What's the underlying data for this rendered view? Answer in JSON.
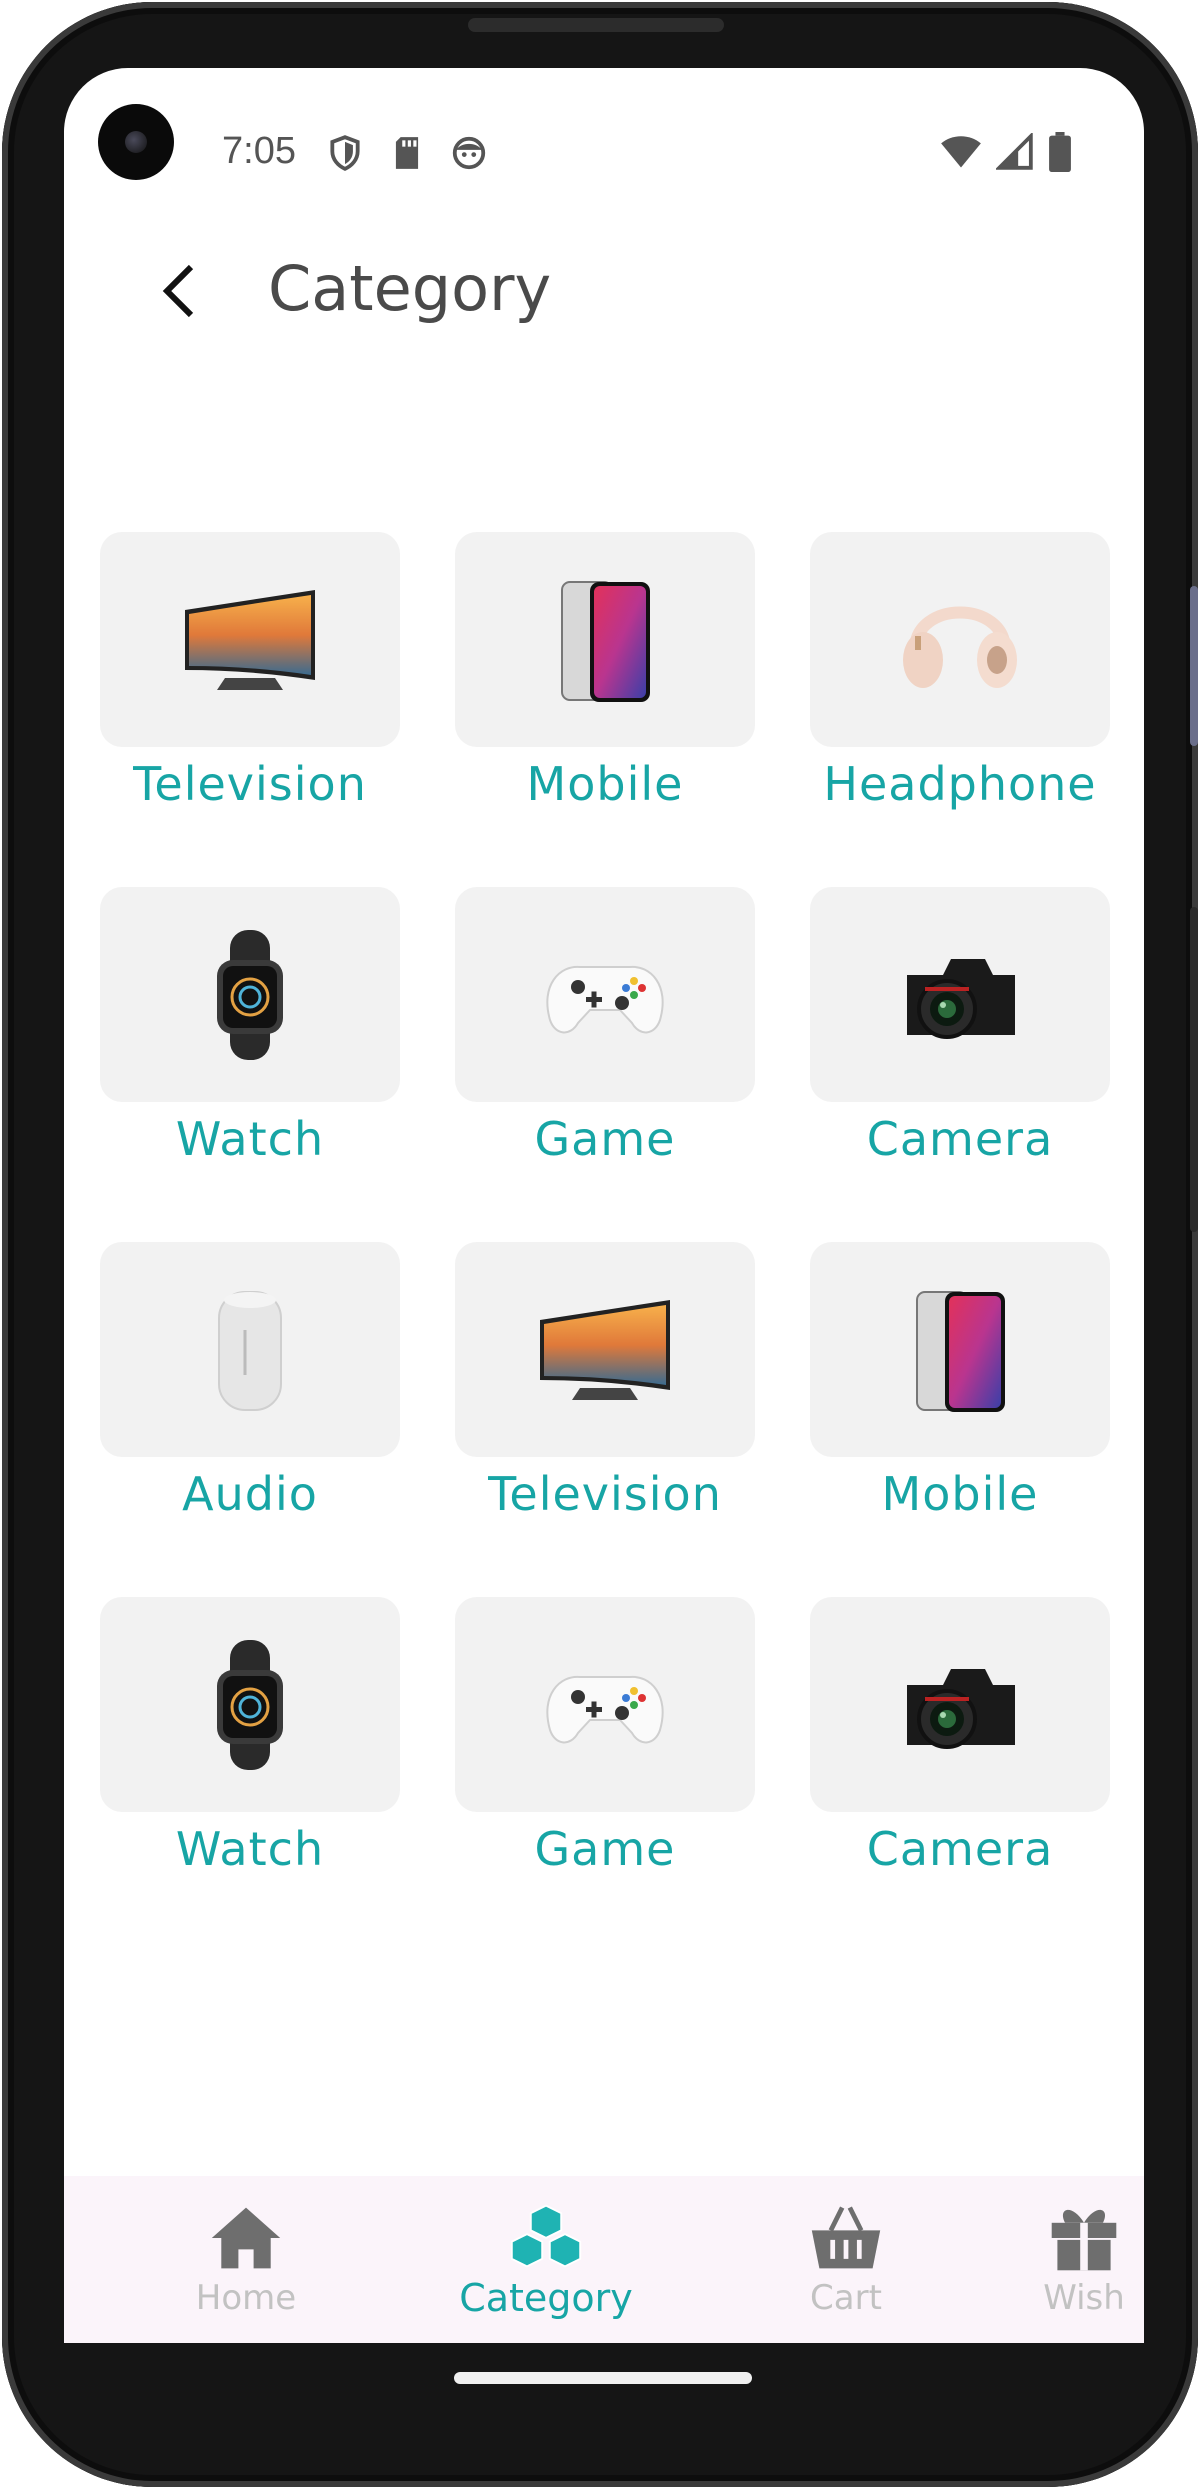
{
  "status": {
    "time": "7:05",
    "left_icons": [
      "shield-icon",
      "sd-card-icon",
      "face-icon"
    ],
    "right_icons": [
      "wifi-icon",
      "signal-icon",
      "battery-icon"
    ]
  },
  "header": {
    "title": "Category",
    "back_icon": "back-arrow-icon"
  },
  "categories": [
    {
      "label": "Television",
      "icon": "television"
    },
    {
      "label": "Mobile",
      "icon": "mobile"
    },
    {
      "label": "Headphone",
      "icon": "headphone"
    },
    {
      "label": "Watch",
      "icon": "watch"
    },
    {
      "label": "Game",
      "icon": "game"
    },
    {
      "label": "Camera",
      "icon": "camera"
    },
    {
      "label": "Audio",
      "icon": "audio"
    },
    {
      "label": "Television",
      "icon": "television"
    },
    {
      "label": "Mobile",
      "icon": "mobile"
    },
    {
      "label": "Watch",
      "icon": "watch"
    },
    {
      "label": "Game",
      "icon": "game"
    },
    {
      "label": "Camera",
      "icon": "camera"
    }
  ],
  "bottom_nav": {
    "items": [
      {
        "label": "Home",
        "icon": "home-icon",
        "active": false
      },
      {
        "label": "Category",
        "icon": "category-icon",
        "active": true
      },
      {
        "label": "Cart",
        "icon": "basket-icon",
        "active": false
      },
      {
        "label": "Wish",
        "icon": "gift-icon",
        "active": false
      }
    ]
  },
  "colors": {
    "accent": "#17a5a5",
    "inactive": "#c2c2c2",
    "card": "#f2f2f2",
    "nav_bg": "#fbf4fa"
  }
}
